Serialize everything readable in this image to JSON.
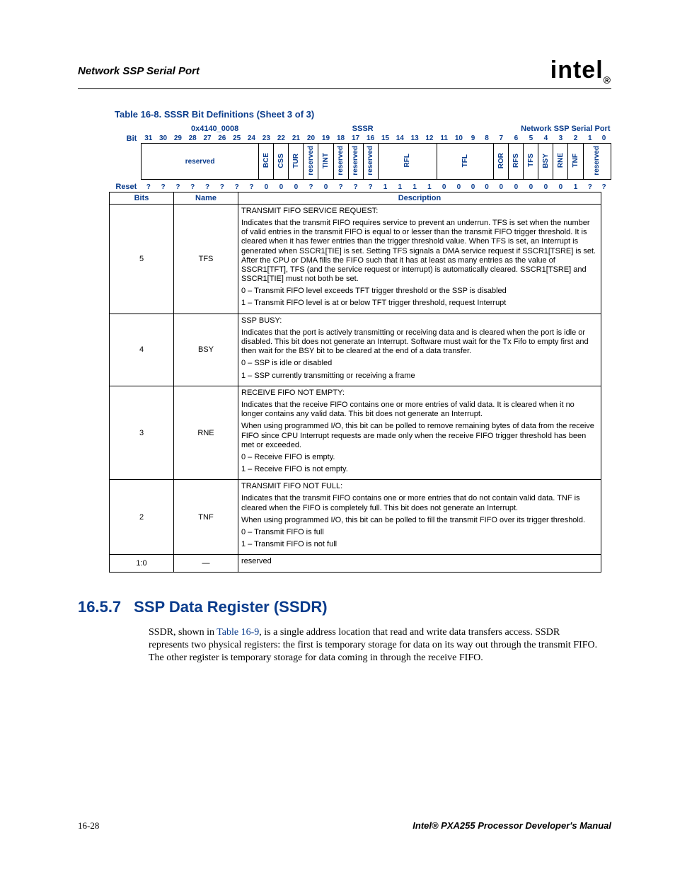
{
  "header": {
    "left": "Network SSP Serial Port",
    "logo": "intel",
    "logo_sub": "®"
  },
  "table_caption": "Table 16-8. SSSR Bit Definitions (Sheet 3 of 3)",
  "reg_header": {
    "addr": "0x4140_0008",
    "name": "SSSR",
    "module": "Network SSP Serial Port"
  },
  "row_labels": {
    "bit": "Bit",
    "reset": "Reset"
  },
  "bit_numbers": [
    "31",
    "30",
    "29",
    "28",
    "27",
    "26",
    "25",
    "24",
    "23",
    "22",
    "21",
    "20",
    "19",
    "18",
    "17",
    "16",
    "15",
    "14",
    "13",
    "12",
    "11",
    "10",
    "9",
    "8",
    "7",
    "6",
    "5",
    "4",
    "3",
    "2",
    "1",
    "0"
  ],
  "bit_fields": [
    {
      "label": "reserved",
      "span": 8,
      "vertical": false
    },
    {
      "label": "BCE",
      "span": 1,
      "vertical": true
    },
    {
      "label": "CSS",
      "span": 1,
      "vertical": true
    },
    {
      "label": "TUR",
      "span": 1,
      "vertical": true
    },
    {
      "label": "reserved",
      "span": 1,
      "vertical": true
    },
    {
      "label": "TINT",
      "span": 1,
      "vertical": true
    },
    {
      "label": "reserved",
      "span": 1,
      "vertical": true
    },
    {
      "label": "reserved",
      "span": 1,
      "vertical": true
    },
    {
      "label": "reserved",
      "span": 1,
      "vertical": true
    },
    {
      "label": "RFL",
      "span": 4,
      "vertical": true
    },
    {
      "label": "TFL",
      "span": 4,
      "vertical": true
    },
    {
      "label": "ROR",
      "span": 1,
      "vertical": true
    },
    {
      "label": "RFS",
      "span": 1,
      "vertical": true
    },
    {
      "label": "TFS",
      "span": 1,
      "vertical": true
    },
    {
      "label": "BSY",
      "span": 1,
      "vertical": true
    },
    {
      "label": "RNE",
      "span": 1,
      "vertical": true
    },
    {
      "label": "TNF",
      "span": 1,
      "vertical": true
    },
    {
      "label": "reserved",
      "span": 2,
      "vertical": true
    }
  ],
  "reset_values": [
    "?",
    "?",
    "?",
    "?",
    "?",
    "?",
    "?",
    "?",
    "0",
    "0",
    "0",
    "?",
    "0",
    "?",
    "?",
    "?",
    "1",
    "1",
    "1",
    "1",
    "0",
    "0",
    "0",
    "0",
    "0",
    "0",
    "0",
    "0",
    "0",
    "1",
    "?",
    "?"
  ],
  "def_headers": {
    "bits": "Bits",
    "name": "Name",
    "desc": "Description"
  },
  "def_rows": [
    {
      "bits": "5",
      "name": "TFS",
      "desc": [
        {
          "t": "TRANSMIT FIFO SERVICE REQUEST:"
        },
        {
          "t": "Indicates that the transmit FIFO requires service to prevent an underrun. TFS is set when the number of valid entries in the transmit FIFO is equal to or lesser than the transmit FIFO trigger threshold. It is cleared when it has fewer entries than the trigger threshold value. When TFS is set, an Interrupt is generated when SSCR1[TIE] is set. Setting TFS signals a DMA service request if SSCR1[TSRE] is set. After the CPU or DMA fills the FIFO such that it has at least as many entries as the value of SSCR1[TFT], TFS (and the service request or interrupt) is automatically cleared. SSCR1[TSRE] and SSCR1[TIE] must not both be set."
        },
        {
          "t": "0 –   Transmit FIFO level exceeds TFT trigger threshold or the SSP is disabled",
          "item": true
        },
        {
          "t": "1 –   Transmit FIFO level is at or below TFT trigger threshold, request Interrupt",
          "item": true
        }
      ]
    },
    {
      "bits": "4",
      "name": "BSY",
      "desc": [
        {
          "t": "SSP BUSY:"
        },
        {
          "t": "Indicates that the port is actively transmitting or receiving data and is cleared when the port is idle or disabled. This bit does not generate an Interrupt. Software must wait for the Tx Fifo to empty first and then wait for the BSY bit to be cleared at the end of a data transfer."
        },
        {
          "t": "0 –   SSP is idle or disabled",
          "item": true
        },
        {
          "t": "1 –   SSP currently transmitting or receiving a frame",
          "item": true
        }
      ]
    },
    {
      "bits": "3",
      "name": "RNE",
      "desc": [
        {
          "t": "RECEIVE FIFO NOT EMPTY:"
        },
        {
          "t": "Indicates that the receive FIFO contains one or more entries of valid data. It is cleared when it no longer contains any valid data. This bit does not generate an Interrupt."
        },
        {
          "t": "When using programmed I/O, this bit can be polled to remove remaining bytes of data from the receive FIFO since CPU Interrupt requests are made only when the receive FIFO trigger threshold has been met or exceeded."
        },
        {
          "t": "0 –   Receive FIFO is empty.",
          "item": true
        },
        {
          "t": "1 –   Receive FIFO is not empty.",
          "item": true
        }
      ]
    },
    {
      "bits": "2",
      "name": "TNF",
      "desc": [
        {
          "t": "TRANSMIT FIFO NOT FULL:"
        },
        {
          "t": "Indicates that the transmit FIFO contains one or more entries that do not contain valid data. TNF is cleared when the FIFO is completely full. This bit does not generate an Interrupt."
        },
        {
          "t": "When using programmed I/O, this bit can be polled to fill the transmit FIFO over its trigger threshold."
        },
        {
          "t": "0 –   Transmit FIFO is full",
          "item": true
        },
        {
          "t": "1 –   Transmit FIFO is not full",
          "item": true
        }
      ]
    },
    {
      "bits": "1:0",
      "name": "—",
      "desc": [
        {
          "t": "reserved"
        }
      ]
    }
  ],
  "section": {
    "num": "16.5.7",
    "title": "SSP Data Register (SSDR)",
    "para_pre": "SSDR, shown in ",
    "link": "Table 16-9",
    "para_post": ", is a single address location that read and write data transfers access. SSDR represents two physical registers: the first is temporary storage for data on its way out through the transmit FIFO. The other register is temporary storage for data coming in through the receive FIFO."
  },
  "footer": {
    "left": "16-28",
    "right": "Intel® PXA255 Processor Developer's Manual"
  }
}
